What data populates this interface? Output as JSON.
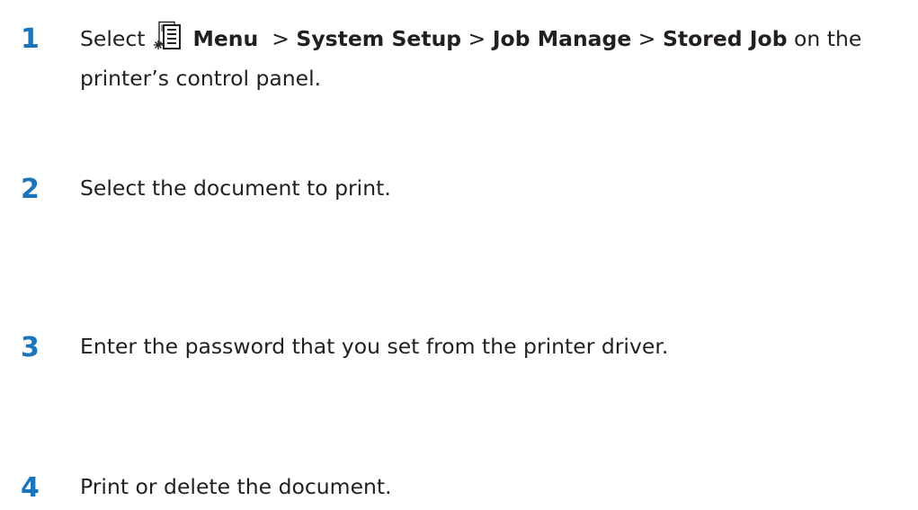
{
  "steps": [
    {
      "number": "1",
      "select_label": "Select",
      "menu_label": "Menu",
      "sep1": ">",
      "item1": "System Setup",
      "sep2": ">",
      "item2": "Job Manage",
      "sep3": ">",
      "item3": "Stored Job",
      "tail": "on the printer’s control panel."
    },
    {
      "number": "2",
      "text": "Select the document to print."
    },
    {
      "number": "3",
      "text": "Enter the password that you set from the printer driver."
    },
    {
      "number": "4",
      "text": "Print or delete the document."
    }
  ],
  "colors": {
    "step_number": "#1a75bc",
    "body_text": "#231f20"
  },
  "icons": {
    "menu": "menu-button-icon"
  }
}
